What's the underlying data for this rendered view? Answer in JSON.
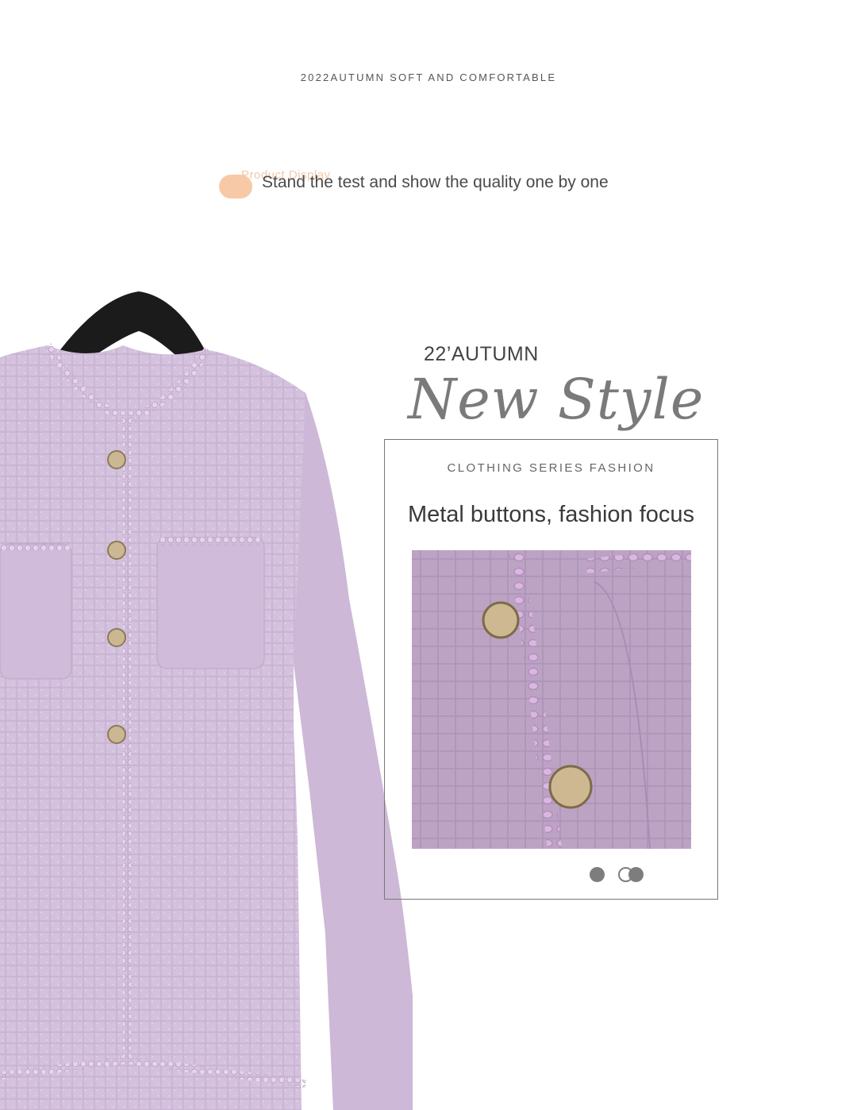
{
  "header": {
    "tagline": "2022AUTUMN SOFT AND COMFORTABLE",
    "ghost_label": "Product Display",
    "subtitle": "Stand the test and show the quality one by one"
  },
  "feature_block": {
    "season": "22’AUTUMN",
    "headline": "New Style",
    "series": "CLOTHING SERIES FASHION",
    "caption": "Metal buttons, fashion focus"
  },
  "carousel": {
    "slide_count": 2,
    "active_index": 0
  },
  "colors": {
    "jacket": "#d4c1dd",
    "trim": "#e2cde8",
    "button_gold": "#c8b48a",
    "hanger": "#1b1b1b",
    "accent_peach": "#f7c9a6"
  },
  "icons": [
    "hanger-icon",
    "metal-button-icon",
    "carousel-dot-icon"
  ]
}
